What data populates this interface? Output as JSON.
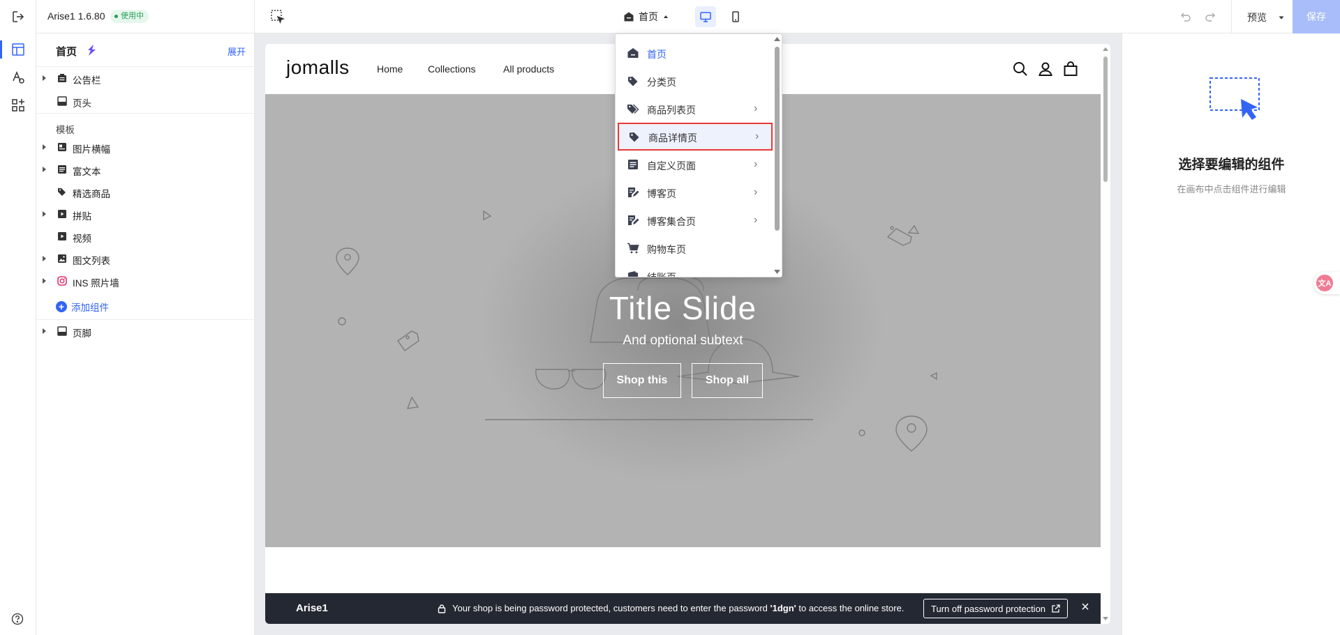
{
  "topbar": {
    "app_name": "Arise1 1.6.80",
    "status_badge": "使用中",
    "current_page": "首页",
    "preview_label": "预览",
    "save_label": "保存"
  },
  "sidebar": {
    "title": "首页",
    "expand_label": "展开",
    "sections": {
      "announcement": "公告栏",
      "header": "页头",
      "template_label": "模板",
      "templates": [
        "图片横幅",
        "富文本",
        "精选商品",
        "拼贴",
        "视频",
        "图文列表",
        "INS 照片墙"
      ],
      "add_component": "添加组件",
      "footer": "页脚"
    }
  },
  "dropdown": {
    "items": [
      {
        "label": "首页",
        "icon": "home-icon"
      },
      {
        "label": "分类页",
        "icon": "tag-icon"
      },
      {
        "label": "商品列表页",
        "icon": "tags-icon"
      },
      {
        "label": "商品详情页",
        "icon": "tag-icon"
      },
      {
        "label": "自定义页面",
        "icon": "document-icon"
      },
      {
        "label": "博客页",
        "icon": "edit-doc-icon"
      },
      {
        "label": "博客集合页",
        "icon": "edit-doc-icon"
      },
      {
        "label": "购物车页",
        "icon": "cart-icon"
      },
      {
        "label": "结账页",
        "icon": "wallet-icon"
      }
    ]
  },
  "store": {
    "logo": "jomalls",
    "nav": [
      "Home",
      "Collections",
      "All products"
    ],
    "hero_title": "Title Slide",
    "hero_subtitle": "And optional subtext",
    "hero_buttons": [
      "Shop this",
      "Shop all"
    ],
    "password_bar": {
      "store_name": "Arise1",
      "message_prefix": "Your shop is being password protected, customers need to enter the password ",
      "password": "'1dgn'",
      "message_suffix": " to access the online store.",
      "button": "Turn off password protection"
    }
  },
  "right_panel": {
    "title": "选择要编辑的组件",
    "subtitle": "在画布中点击组件进行编辑"
  },
  "colors": {
    "accent": "#3264f6",
    "save_disabled": "#a8bdfa",
    "badge_green": "#2a9d58",
    "highlight_border": "#e53935",
    "password_bar_bg": "#242833"
  }
}
